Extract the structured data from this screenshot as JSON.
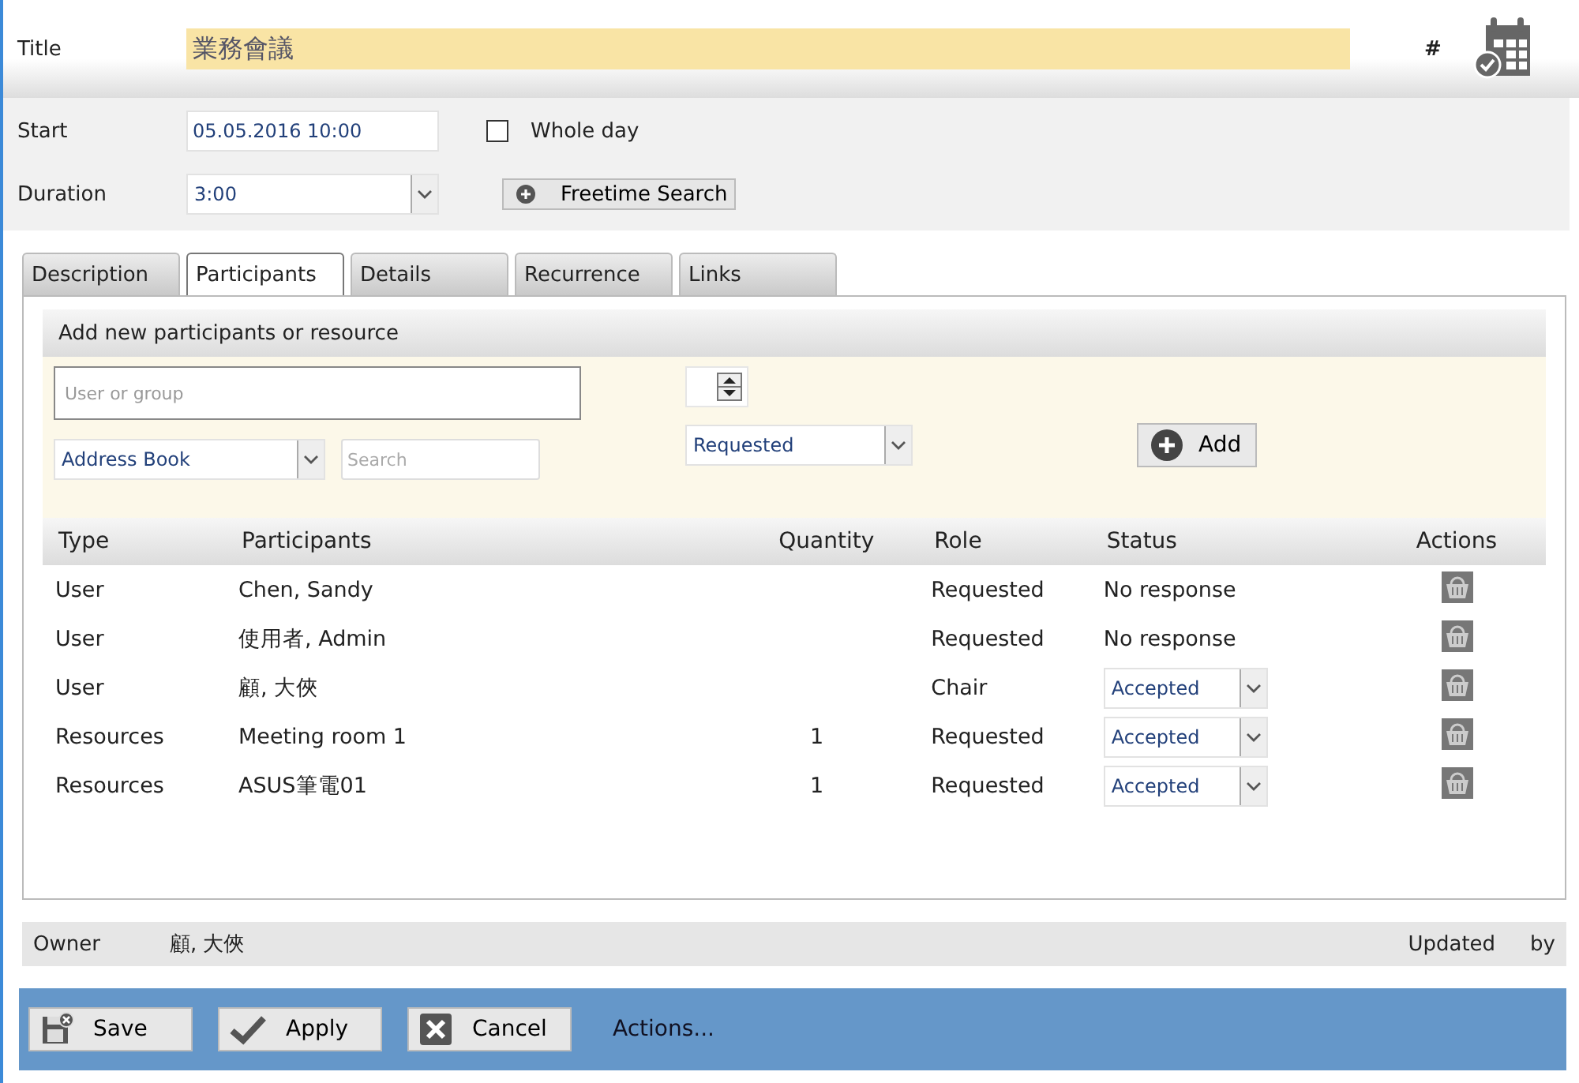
{
  "title_bar": {
    "label": "Title",
    "value": "業務會議",
    "hash": "#"
  },
  "start": {
    "label": "Start",
    "value": "05.05.2016 10:00"
  },
  "whole_day": {
    "label": "Whole day",
    "checked": false
  },
  "duration": {
    "label": "Duration",
    "value": "3:00"
  },
  "freetime_button": "Freetime Search",
  "tabs": [
    {
      "label": "Description",
      "selected": false
    },
    {
      "label": "Participants",
      "selected": true
    },
    {
      "label": "Details",
      "selected": false
    },
    {
      "label": "Recurrence",
      "selected": false
    },
    {
      "label": "Links",
      "selected": false
    }
  ],
  "add_section": {
    "heading": "Add new participants or resource",
    "user_field": {
      "placeholder": "User or group"
    },
    "source": {
      "value": "Address Book"
    },
    "search": {
      "placeholder": "Search"
    },
    "role": {
      "value": "Requested"
    },
    "add_button": "Add"
  },
  "table": {
    "columns": [
      "Type",
      "Participants",
      "Quantity",
      "Role",
      "Status",
      "Actions"
    ],
    "rows": [
      {
        "type": "User",
        "participant": "Chen, Sandy",
        "role": "Requested",
        "status": {
          "kind": "text",
          "value": "No response"
        }
      },
      {
        "type": "User",
        "participant": "使用者, Admin",
        "role": "Requested",
        "status": {
          "kind": "text",
          "value": "No response"
        }
      },
      {
        "type": "User",
        "participant": "顧, 大俠",
        "role": "Chair",
        "status": {
          "kind": "select",
          "value": "Accepted"
        }
      },
      {
        "type": "Resources",
        "participant": "Meeting room 1",
        "quantity": "1",
        "role": "Requested",
        "status": {
          "kind": "select",
          "value": "Accepted"
        }
      },
      {
        "type": "Resources",
        "participant": "ASUS筆電01",
        "quantity": "1",
        "role": "Requested",
        "status": {
          "kind": "select",
          "value": "Accepted"
        }
      }
    ]
  },
  "owner_bar": {
    "label": "Owner",
    "value": "顧, 大俠",
    "updated": "Updated",
    "by": "by"
  },
  "buttons": [
    {
      "kind": "save",
      "label": "Save"
    },
    {
      "kind": "apply",
      "label": "Apply"
    },
    {
      "kind": "cancel",
      "label": "Cancel"
    }
  ],
  "actions_link": "Actions..."
}
